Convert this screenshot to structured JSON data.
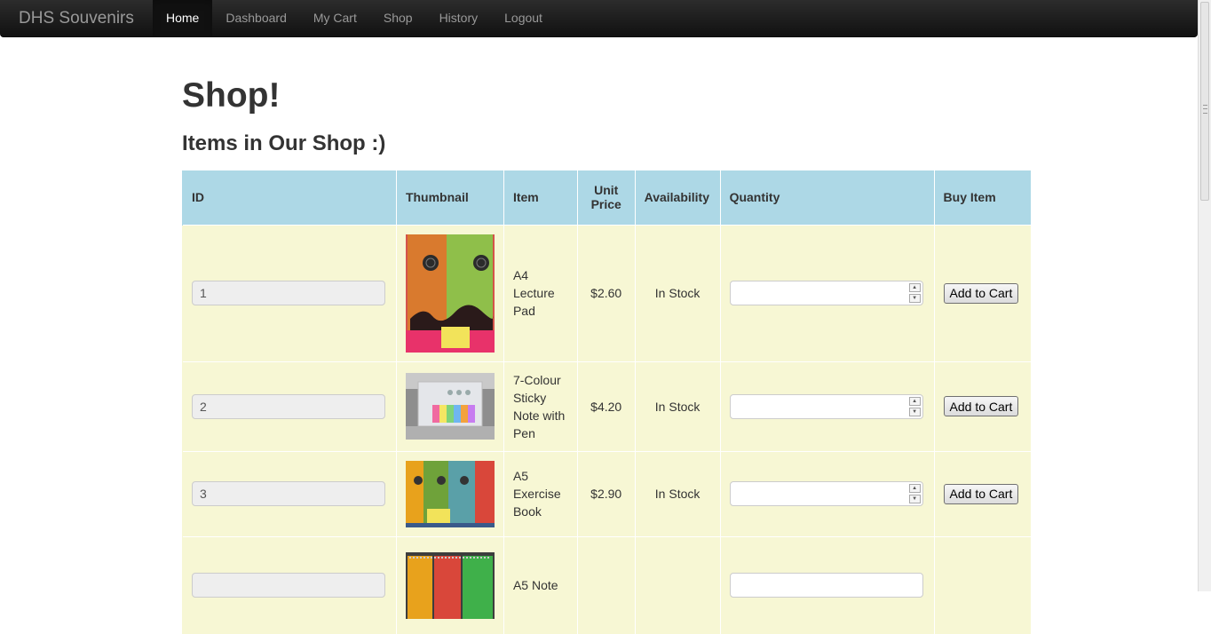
{
  "navbar": {
    "brand": "DHS Souvenirs",
    "items": [
      {
        "label": "Home",
        "active": true
      },
      {
        "label": "Dashboard"
      },
      {
        "label": "My Cart"
      },
      {
        "label": "Shop"
      },
      {
        "label": "History"
      },
      {
        "label": "Logout"
      }
    ]
  },
  "page": {
    "title": "Shop!",
    "subtitle": "Items in Our Shop :)"
  },
  "table": {
    "headers": [
      "ID",
      "Thumbnail",
      "Item",
      "Unit Price",
      "Availability",
      "Quantity",
      "Buy Item"
    ],
    "rows": [
      {
        "id": "1",
        "item": "A4 Lecture Pad",
        "price": "$2.60",
        "availability": "In Stock",
        "quantity": "",
        "button": "Add to Cart",
        "thumbnail": "a4-lecture-pad-thumbnail"
      },
      {
        "id": "2",
        "item": "7-Colour Sticky Note with Pen",
        "price": "$4.20",
        "availability": "In Stock",
        "quantity": "",
        "button": "Add to Cart",
        "thumbnail": "sticky-note-thumbnail"
      },
      {
        "id": "3",
        "item": "A5 Exercise Book",
        "price": "$2.90",
        "availability": "In Stock",
        "quantity": "",
        "button": "Add to Cart",
        "thumbnail": "exercise-book-thumbnail"
      },
      {
        "id": "",
        "item": "A5 Note",
        "price": "",
        "availability": "",
        "quantity": "",
        "button": "",
        "thumbnail": "note-book-thumbnail"
      }
    ]
  },
  "colors": {
    "header_bg": "#add8e6",
    "row_bg": "#f7f7d4",
    "navbar_bg": "#1b1b1b"
  }
}
